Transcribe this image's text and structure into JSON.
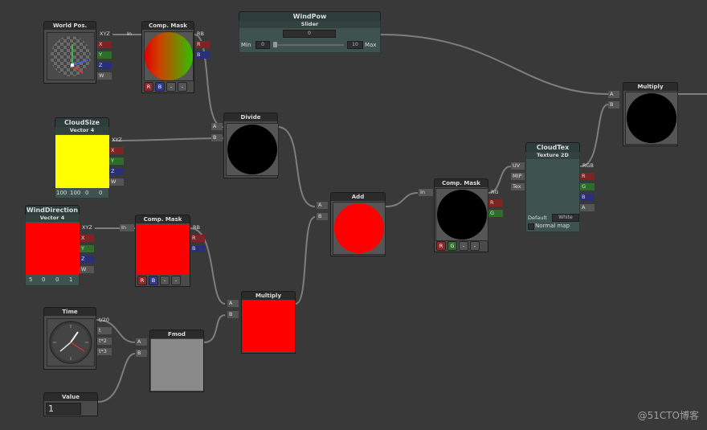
{
  "nodes": {
    "world_pos": {
      "title": "World Pos.",
      "ports": [
        "XYZ",
        "X",
        "Y",
        "Z",
        "W"
      ]
    },
    "comp_mask_1": {
      "title": "Comp. Mask",
      "in_label": "In",
      "ports": [
        "RB",
        "R",
        "B"
      ],
      "buttons": [
        "R",
        "B",
        "-",
        "-"
      ]
    },
    "wind_pow": {
      "title": "WindPow",
      "subtitle": "Slider",
      "value": "0",
      "min_label": "Min",
      "min_value": "0",
      "max_value": "10",
      "max_label": "Max"
    },
    "cloud_size": {
      "title": "CloudSize",
      "subtitle": "Vector 4",
      "ports": [
        "XYZ",
        "X",
        "Y",
        "Z",
        "W"
      ],
      "values": [
        "100",
        "100",
        "0",
        "0"
      ],
      "color": "#ffff00"
    },
    "divide": {
      "title": "Divide",
      "ports": [
        "A",
        "B"
      ]
    },
    "wind_direction": {
      "title": "WindDirection",
      "subtitle": "Vector 4",
      "ports": [
        "XYZ",
        "X",
        "Y",
        "Z",
        "W"
      ],
      "values": [
        "5",
        "0",
        "0",
        "1"
      ],
      "color": "#ff0000"
    },
    "comp_mask_2": {
      "title": "Comp. Mask",
      "in_label": "In",
      "ports": [
        "RB",
        "R",
        "B"
      ],
      "buttons": [
        "R",
        "B",
        "-",
        "-"
      ]
    },
    "add": {
      "title": "Add",
      "ports": [
        "A",
        "B"
      ]
    },
    "comp_mask_3": {
      "title": "Comp. Mask",
      "in_label": "In",
      "ports": [
        "RG",
        "R",
        "G"
      ],
      "buttons": [
        "R",
        "G",
        "-",
        "-"
      ]
    },
    "cloud_tex": {
      "title": "CloudTex",
      "subtitle": "Texture 2D",
      "in_ports": [
        "UV",
        "MIP",
        "Tex"
      ],
      "out_ports": [
        "RGB",
        "R",
        "G",
        "B",
        "A"
      ],
      "default_label": "Default",
      "default_value": "White",
      "normal_map_label": "Normal map"
    },
    "multiply_1": {
      "title": "Multiply",
      "ports": [
        "A",
        "B"
      ]
    },
    "multiply_2": {
      "title": "Multiply",
      "ports": [
        "A",
        "B"
      ]
    },
    "time": {
      "title": "Time",
      "ports": [
        "t/20",
        "t",
        "t*2",
        "t*3"
      ]
    },
    "fmod": {
      "title": "Fmod",
      "ports": [
        "A",
        "B"
      ]
    },
    "value": {
      "title": "Value",
      "value": "1"
    }
  },
  "watermark": "@51CTO博客",
  "colors": {
    "background": "#393939",
    "wire": "#8a8a8a",
    "port_red": "#7e2424",
    "port_green": "#2f6d2a",
    "port_blue": "#2a2f7a"
  }
}
